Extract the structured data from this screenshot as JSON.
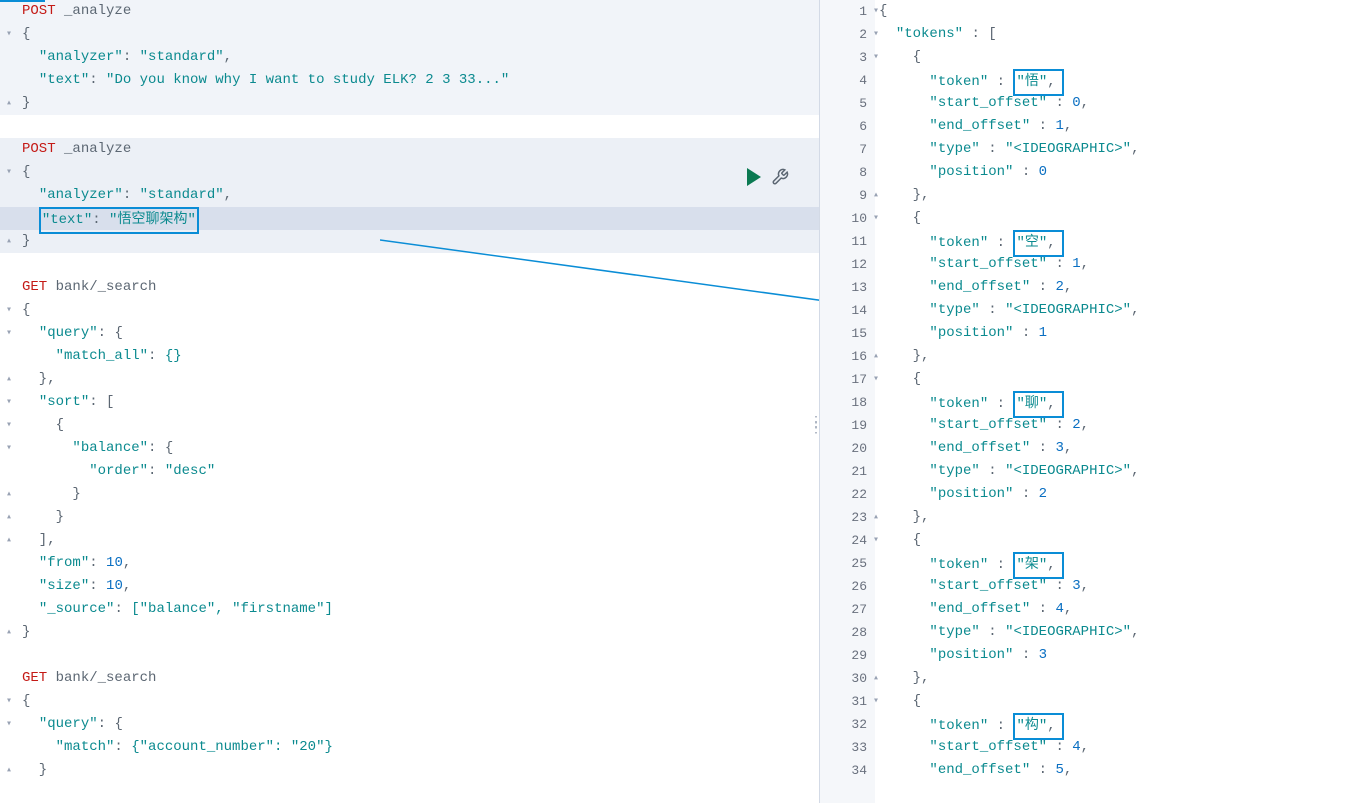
{
  "left": {
    "lines": [
      {
        "type": "req",
        "method": "POST",
        "path": "_analyze",
        "bg": "block1",
        "fold": ""
      },
      {
        "type": "brace",
        "text": "{",
        "bg": "block1",
        "fold": "▾"
      },
      {
        "type": "kv",
        "indent": "  ",
        "key": "analyzer",
        "val": "\"standard\"",
        "comma": ",",
        "bg": "block1",
        "fold": ""
      },
      {
        "type": "kv",
        "indent": "  ",
        "key": "text",
        "val": "\"Do you know why I want to study ELK? 2 3 33...\"",
        "comma": "",
        "bg": "block1",
        "fold": ""
      },
      {
        "type": "brace",
        "text": "}",
        "bg": "block1",
        "fold": "▴"
      },
      {
        "type": "blank",
        "bg": "",
        "fold": ""
      },
      {
        "type": "req",
        "method": "POST",
        "path": "_analyze",
        "bg": "block2",
        "fold": ""
      },
      {
        "type": "brace",
        "text": "{",
        "bg": "block2",
        "fold": "▾"
      },
      {
        "type": "kv",
        "indent": "  ",
        "key": "analyzer",
        "val": "\"standard\"",
        "comma": ",",
        "bg": "block2",
        "fold": ""
      },
      {
        "type": "kv_box",
        "indent": "  ",
        "key": "text",
        "val": "\"悟空聊架构\"",
        "comma": "",
        "bg": "highlighted-line",
        "fold": ""
      },
      {
        "type": "brace",
        "text": "}",
        "bg": "block2",
        "fold": "▴"
      },
      {
        "type": "blank",
        "bg": "",
        "fold": ""
      },
      {
        "type": "req",
        "method": "GET",
        "path": "bank/_search",
        "bg": "",
        "fold": ""
      },
      {
        "type": "brace",
        "text": "{",
        "bg": "",
        "fold": "▾"
      },
      {
        "type": "kv_open",
        "indent": "  ",
        "key": "query",
        "val": "{",
        "bg": "",
        "fold": "▾"
      },
      {
        "type": "kv",
        "indent": "    ",
        "key": "match_all",
        "val": "{}",
        "comma": "",
        "bg": "",
        "fold": ""
      },
      {
        "type": "close",
        "indent": "  ",
        "text": "},",
        "bg": "",
        "fold": "▴"
      },
      {
        "type": "kv_open",
        "indent": "  ",
        "key": "sort",
        "val": "[",
        "bg": "",
        "fold": "▾"
      },
      {
        "type": "brace",
        "text": "    {",
        "bg": "",
        "fold": "▾"
      },
      {
        "type": "kv_open",
        "indent": "      ",
        "key": "balance",
        "val": "{",
        "bg": "",
        "fold": "▾"
      },
      {
        "type": "kv",
        "indent": "        ",
        "key": "order",
        "val": "\"desc\"",
        "comma": "",
        "bg": "",
        "fold": ""
      },
      {
        "type": "close",
        "indent": "      ",
        "text": "}",
        "bg": "",
        "fold": "▴"
      },
      {
        "type": "close",
        "indent": "    ",
        "text": "}",
        "bg": "",
        "fold": "▴"
      },
      {
        "type": "close",
        "indent": "  ",
        "text": "],",
        "bg": "",
        "fold": "▴"
      },
      {
        "type": "kv",
        "indent": "  ",
        "key": "from",
        "val": "10",
        "comma": ",",
        "bg": "",
        "fold": "",
        "num": true
      },
      {
        "type": "kv",
        "indent": "  ",
        "key": "size",
        "val": "10",
        "comma": ",",
        "bg": "",
        "fold": "",
        "num": true
      },
      {
        "type": "kv",
        "indent": "  ",
        "key": "_source",
        "val": "[\"balance\", \"firstname\"]",
        "comma": "",
        "bg": "",
        "fold": ""
      },
      {
        "type": "brace",
        "text": "}",
        "bg": "",
        "fold": "▴"
      },
      {
        "type": "blank",
        "bg": "",
        "fold": ""
      },
      {
        "type": "req",
        "method": "GET",
        "path": "bank/_search",
        "bg": "",
        "fold": ""
      },
      {
        "type": "brace",
        "text": "{",
        "bg": "",
        "fold": "▾"
      },
      {
        "type": "kv_open",
        "indent": "  ",
        "key": "query",
        "val": "{",
        "bg": "",
        "fold": "▾"
      },
      {
        "type": "kv",
        "indent": "    ",
        "key": "match",
        "val": "{\"account_number\": \"20\"}",
        "comma": "",
        "bg": "",
        "fold": ""
      },
      {
        "type": "close",
        "indent": "  ",
        "text": "}",
        "bg": "",
        "fold": "▴"
      }
    ]
  },
  "right": {
    "lines": [
      {
        "n": 1,
        "txt": "{",
        "fold": "▾"
      },
      {
        "n": 2,
        "txt": "  \"tokens\" : [",
        "type": "key",
        "fold": "▾"
      },
      {
        "n": 3,
        "txt": "    {",
        "fold": "▾"
      },
      {
        "n": 4,
        "txt": "      \"token\" : \"悟\",",
        "type": "token_box",
        "token": "悟"
      },
      {
        "n": 5,
        "txt": "      \"start_offset\" : 0,",
        "type": "kv_num",
        "key": "start_offset",
        "val": "0"
      },
      {
        "n": 6,
        "txt": "      \"end_offset\" : 1,",
        "type": "kv_num",
        "key": "end_offset",
        "val": "1"
      },
      {
        "n": 7,
        "txt": "      \"type\" : \"<IDEOGRAPHIC>\",",
        "type": "kv_str",
        "key": "type",
        "val": "<IDEOGRAPHIC>"
      },
      {
        "n": 8,
        "txt": "      \"position\" : 0",
        "type": "kv_num",
        "key": "position",
        "val": "0",
        "nc": true
      },
      {
        "n": 9,
        "txt": "    },",
        "fold": "▴"
      },
      {
        "n": 10,
        "txt": "    {",
        "fold": "▾"
      },
      {
        "n": 11,
        "txt": "      \"token\" : \"空\",",
        "type": "token_box",
        "token": "空"
      },
      {
        "n": 12,
        "txt": "      \"start_offset\" : 1,",
        "type": "kv_num",
        "key": "start_offset",
        "val": "1"
      },
      {
        "n": 13,
        "txt": "      \"end_offset\" : 2,",
        "type": "kv_num",
        "key": "end_offset",
        "val": "2"
      },
      {
        "n": 14,
        "txt": "      \"type\" : \"<IDEOGRAPHIC>\",",
        "type": "kv_str",
        "key": "type",
        "val": "<IDEOGRAPHIC>"
      },
      {
        "n": 15,
        "txt": "      \"position\" : 1",
        "type": "kv_num",
        "key": "position",
        "val": "1",
        "nc": true
      },
      {
        "n": 16,
        "txt": "    },",
        "fold": "▴"
      },
      {
        "n": 17,
        "txt": "    {",
        "fold": "▾"
      },
      {
        "n": 18,
        "txt": "      \"token\" : \"聊\",",
        "type": "token_box",
        "token": "聊"
      },
      {
        "n": 19,
        "txt": "      \"start_offset\" : 2,",
        "type": "kv_num",
        "key": "start_offset",
        "val": "2"
      },
      {
        "n": 20,
        "txt": "      \"end_offset\" : 3,",
        "type": "kv_num",
        "key": "end_offset",
        "val": "3"
      },
      {
        "n": 21,
        "txt": "      \"type\" : \"<IDEOGRAPHIC>\",",
        "type": "kv_str",
        "key": "type",
        "val": "<IDEOGRAPHIC>"
      },
      {
        "n": 22,
        "txt": "      \"position\" : 2",
        "type": "kv_num",
        "key": "position",
        "val": "2",
        "nc": true
      },
      {
        "n": 23,
        "txt": "    },",
        "fold": "▴"
      },
      {
        "n": 24,
        "txt": "    {",
        "fold": "▾"
      },
      {
        "n": 25,
        "txt": "      \"token\" : \"架\",",
        "type": "token_box",
        "token": "架"
      },
      {
        "n": 26,
        "txt": "      \"start_offset\" : 3,",
        "type": "kv_num",
        "key": "start_offset",
        "val": "3"
      },
      {
        "n": 27,
        "txt": "      \"end_offset\" : 4,",
        "type": "kv_num",
        "key": "end_offset",
        "val": "4"
      },
      {
        "n": 28,
        "txt": "      \"type\" : \"<IDEOGRAPHIC>\",",
        "type": "kv_str",
        "key": "type",
        "val": "<IDEOGRAPHIC>"
      },
      {
        "n": 29,
        "txt": "      \"position\" : 3",
        "type": "kv_num",
        "key": "position",
        "val": "3",
        "nc": true
      },
      {
        "n": 30,
        "txt": "    },",
        "fold": "▴"
      },
      {
        "n": 31,
        "txt": "    {",
        "fold": "▾"
      },
      {
        "n": 32,
        "txt": "      \"token\" : \"构\",",
        "type": "token_box",
        "token": "构"
      },
      {
        "n": 33,
        "txt": "      \"start_offset\" : 4,",
        "type": "kv_num",
        "key": "start_offset",
        "val": "4"
      },
      {
        "n": 34,
        "txt": "      \"end_offset\" : 5,",
        "type": "kv_num",
        "key": "end_offset",
        "val": "5"
      }
    ]
  },
  "chart_data": {
    "type": "table",
    "title": "Elasticsearch _analyze response tokens",
    "columns": [
      "token",
      "start_offset",
      "end_offset",
      "type",
      "position"
    ],
    "rows": [
      [
        "悟",
        0,
        1,
        "<IDEOGRAPHIC>",
        0
      ],
      [
        "空",
        1,
        2,
        "<IDEOGRAPHIC>",
        1
      ],
      [
        "聊",
        2,
        3,
        "<IDEOGRAPHIC>",
        2
      ],
      [
        "架",
        3,
        4,
        "<IDEOGRAPHIC>",
        3
      ],
      [
        "构",
        4,
        5,
        "<IDEOGRAPHIC>",
        4
      ]
    ]
  }
}
